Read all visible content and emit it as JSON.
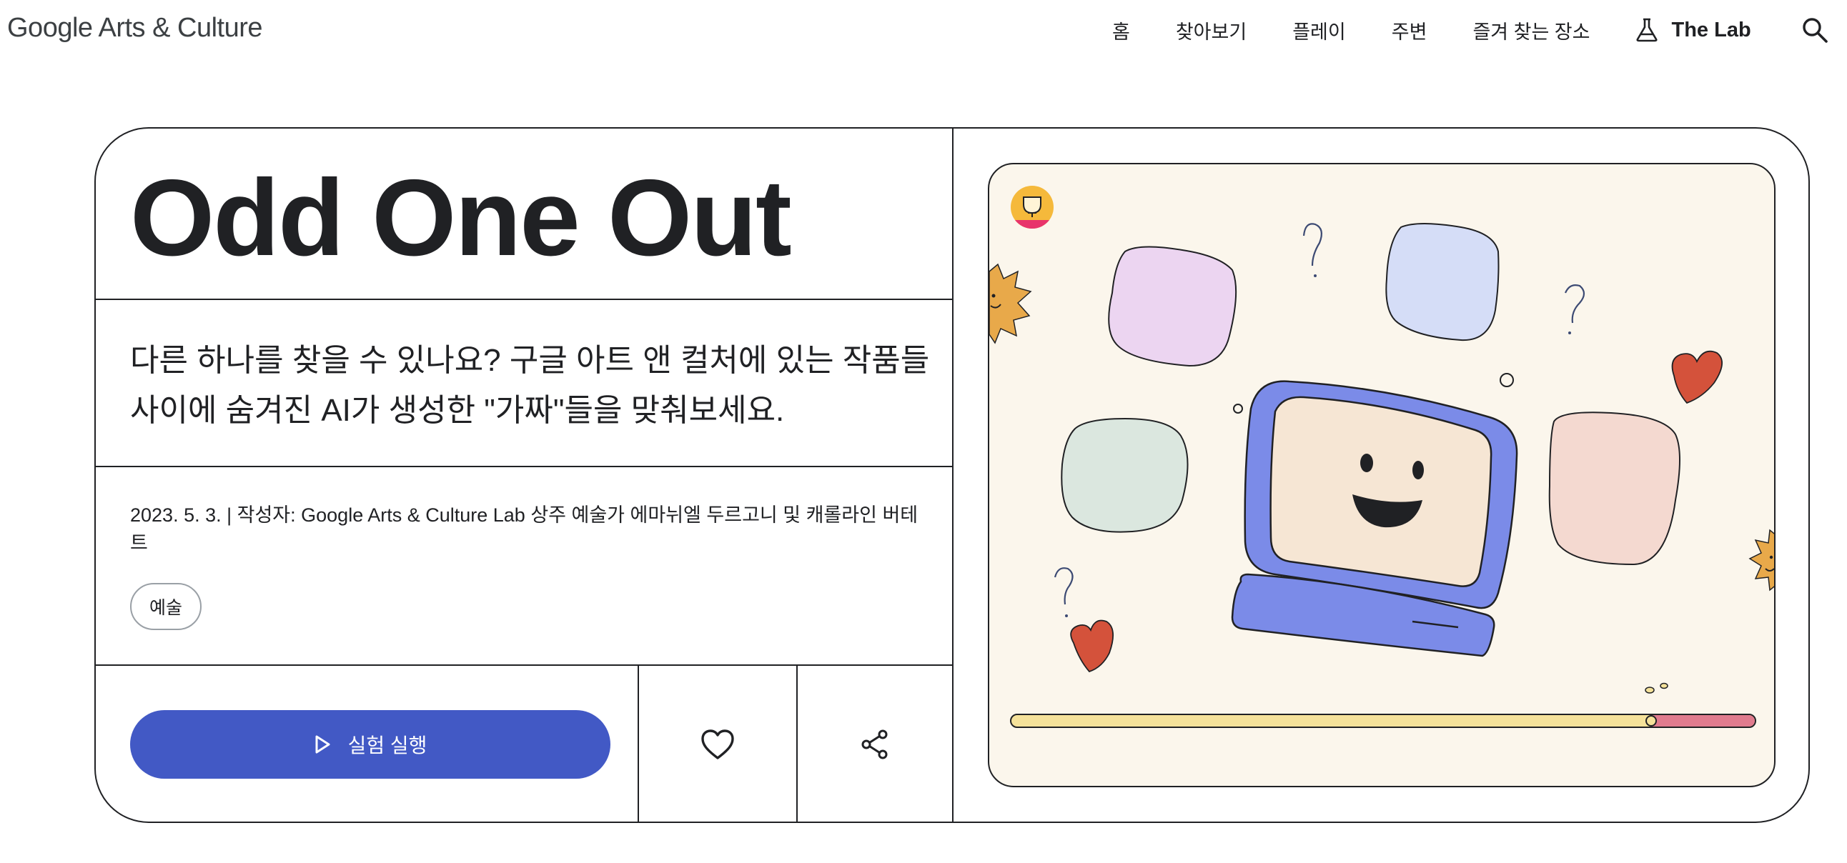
{
  "header": {
    "logo": "Google Arts & Culture",
    "nav": [
      "홈",
      "찾아보기",
      "플레이",
      "주변",
      "즐겨 찾는 장소"
    ],
    "lab_label": "The Lab"
  },
  "card": {
    "title": "Odd One Out",
    "description": "다른 하나를 찾을 수 있나요? 구글 아트 앤 컬처에 있는 작품들 사이에 숨겨진 AI가 생성한 \"가짜\"들을 맞춰보세요.",
    "meta": "2023. 5. 3. | 작성자: Google Arts & Culture Lab 상주 예술가 에마뉘엘 두르고니 및 캐롤라인 버테트",
    "tag": "예술",
    "run_label": "실험 실행"
  },
  "colors": {
    "accent": "#4259c5",
    "ink": "#202124",
    "illustration_bg": "#fbf6ec"
  },
  "icons": [
    "flask-icon",
    "search-icon",
    "play-icon",
    "heart-icon",
    "share-icon"
  ]
}
